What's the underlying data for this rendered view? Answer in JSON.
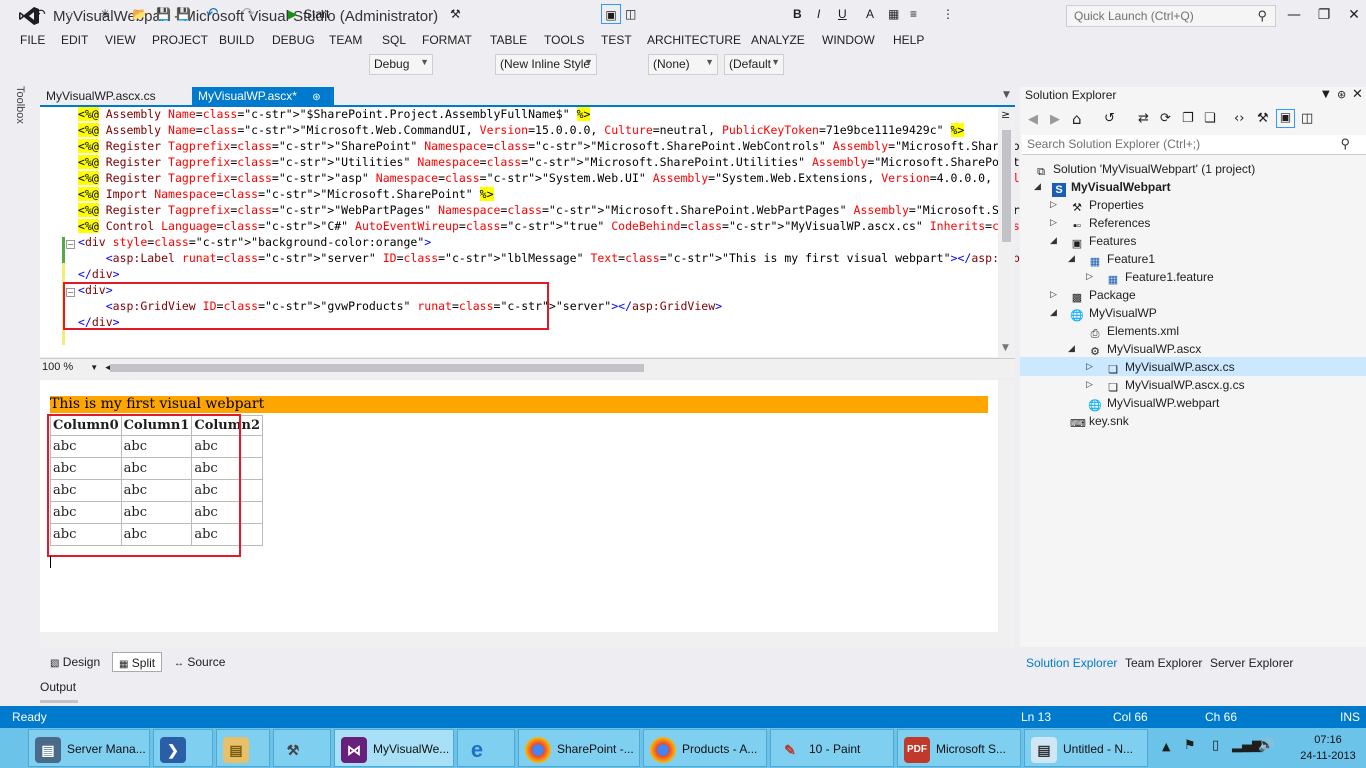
{
  "window": {
    "title": "MyVisualWebpart - Microsoft Visual Studio (Administrator)",
    "quick_launch_placeholder": "Quick Launch (Ctrl+Q)"
  },
  "menu": [
    "FILE",
    "EDIT",
    "VIEW",
    "PROJECT",
    "BUILD",
    "DEBUG",
    "TEAM",
    "SQL",
    "FORMAT",
    "TABLE",
    "TOOLS",
    "TEST",
    "ARCHITECTURE",
    "ANALYZE",
    "WINDOW",
    "HELP"
  ],
  "toolbar": {
    "start_label": "Start",
    "config": "Debug",
    "style_combo": "(New Inline Style",
    "none_combo": "(None)",
    "default_combo": "(Default",
    "bold": "B",
    "italic": "I",
    "underline": "U"
  },
  "toolbox_label": "Toolbox",
  "doc_tabs": [
    {
      "label": "MyVisualWP.ascx.cs",
      "active": false
    },
    {
      "label": "MyVisualWP.ascx*",
      "active": true
    }
  ],
  "code_lines": [
    "<%@ Assembly Name=\"$SharePoint.Project.AssemblyFullName$\" %>",
    "<%@ Assembly Name=\"Microsoft.Web.CommandUI, Version=15.0.0.0, Culture=neutral, PublicKeyToken=71e9bce111e9429c\" %>",
    "<%@ Register Tagprefix=\"SharePoint\" Namespace=\"Microsoft.SharePoint.WebControls\" Assembly=\"Microsoft.SharePoint, Version=15.0.0.0, C",
    "<%@ Register Tagprefix=\"Utilities\" Namespace=\"Microsoft.SharePoint.Utilities\" Assembly=\"Microsoft.SharePoint, Version=15.0.0.0, Cult",
    "<%@ Register Tagprefix=\"asp\" Namespace=\"System.Web.UI\" Assembly=\"System.Web.Extensions, Version=4.0.0.0, Culture=neutral, PublicKey",
    "<%@ Import Namespace=\"Microsoft.SharePoint\" %>",
    "<%@ Register Tagprefix=\"WebPartPages\" Namespace=\"Microsoft.SharePoint.WebPartPages\" Assembly=\"Microsoft.SharePoint, Version=15.0.0.0",
    "<%@ Control Language=\"C#\" AutoEventWireup=\"true\" CodeBehind=\"MyVisualWP.ascx.cs\" Inherits=\"MyVisualWebpart.MyVisualWP.MyVisualWP\" %>",
    "<div style=\"background-color:orange\">",
    "    <asp:Label runat=\"server\" ID=\"lblMessage\" Text=\"This is my first visual webpart\"></asp:Label>",
    "</div>",
    "<div>",
    "    <asp:GridView ID=\"gvwProducts\" runat=\"server\"></asp:GridView>",
    "</div>"
  ],
  "zoom": "100 %",
  "design": {
    "label_text": "This is my first visual webpart",
    "grid_headers": [
      "Column0",
      "Column1",
      "Column2"
    ],
    "grid_rows": [
      [
        "abc",
        "abc",
        "abc"
      ],
      [
        "abc",
        "abc",
        "abc"
      ],
      [
        "abc",
        "abc",
        "abc"
      ],
      [
        "abc",
        "abc",
        "abc"
      ],
      [
        "abc",
        "abc",
        "abc"
      ]
    ]
  },
  "view_tabs": [
    "Design",
    "Split",
    "Source"
  ],
  "output_label": "Output",
  "solution_explorer": {
    "title": "Solution Explorer",
    "search_placeholder": "Search Solution Explorer (Ctrl+;)",
    "items": [
      {
        "label": "Solution 'MyVisualWebpart' (1 project)",
        "icon": "solution-icon"
      },
      {
        "label": "MyVisualWebpart",
        "icon": "sharepoint-project-icon",
        "bold": true
      },
      {
        "label": "Properties",
        "icon": "wrench-icon"
      },
      {
        "label": "References",
        "icon": "references-icon"
      },
      {
        "label": "Features",
        "icon": "folder-icon"
      },
      {
        "label": "Feature1",
        "icon": "feature-icon"
      },
      {
        "label": "Feature1.feature",
        "icon": "feature-file-icon"
      },
      {
        "label": "Package",
        "icon": "package-icon"
      },
      {
        "label": "MyVisualWP",
        "icon": "webpart-icon"
      },
      {
        "label": "Elements.xml",
        "icon": "xml-file-icon"
      },
      {
        "label": "MyVisualWP.ascx",
        "icon": "ascx-icon"
      },
      {
        "label": "MyVisualWP.ascx.cs",
        "icon": "cs-file-icon"
      },
      {
        "label": "MyVisualWP.ascx.g.cs",
        "icon": "cs-file-icon"
      },
      {
        "label": "MyVisualWP.webpart",
        "icon": "webpart-file-icon"
      },
      {
        "label": "key.snk",
        "icon": "key-icon"
      }
    ],
    "bottom_tabs": [
      "Solution Explorer",
      "Team Explorer",
      "Server Explorer"
    ]
  },
  "status": {
    "ready": "Ready",
    "ln": "Ln 13",
    "col": "Col 66",
    "ch": "Ch 66",
    "ins": "INS"
  },
  "taskbar": {
    "items": [
      "Server Mana...",
      "",
      "",
      "",
      "MyVisualWe...",
      "",
      "SharePoint -...",
      "Products - A...",
      "10 - Paint",
      "Microsoft S...",
      "Untitled - N..."
    ],
    "time": "07:16",
    "date": "24-11-2013"
  },
  "colors": {
    "accent": "#007acc",
    "highlight": "#ffff00",
    "orange": "#ffa500",
    "red_box": "#e0192b",
    "taskbar": "#6cc3ea"
  }
}
